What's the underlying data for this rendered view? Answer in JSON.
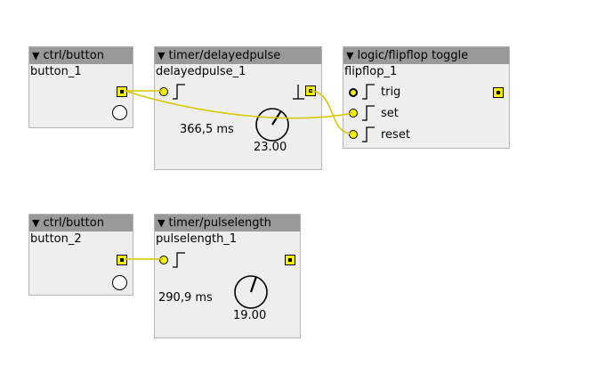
{
  "colors": {
    "canvas": "#ffffff",
    "object_bg": "#eeeeee",
    "header_bg": "#999999",
    "port": "#f5f200",
    "wire": "#d8c800"
  },
  "objects": {
    "button1": {
      "type": "ctrl/button",
      "name": "button_1"
    },
    "delayedpulse": {
      "type": "timer/delayedpulse",
      "name": "delayedpulse_1",
      "time": "366,5 ms",
      "knob_value": "23.00",
      "knob_level": 0.62
    },
    "flipflop": {
      "type": "logic/flipflop toggle",
      "name": "flipflop_1",
      "inlets": [
        "trig",
        "set",
        "reset"
      ]
    },
    "button2": {
      "type": "ctrl/button",
      "name": "button_2"
    },
    "pulselength": {
      "type": "timer/pulselength",
      "name": "pulselength_1",
      "time": "290,9 ms",
      "knob_value": "19.00",
      "knob_level": 0.57
    }
  },
  "icons": {
    "collapse": "triangle-down-icon",
    "inlet": "inlet-dot-icon",
    "outlet": "outlet-square-icon",
    "rising_edge": "rising-edge-icon",
    "falling_edge": "falling-edge-icon"
  }
}
